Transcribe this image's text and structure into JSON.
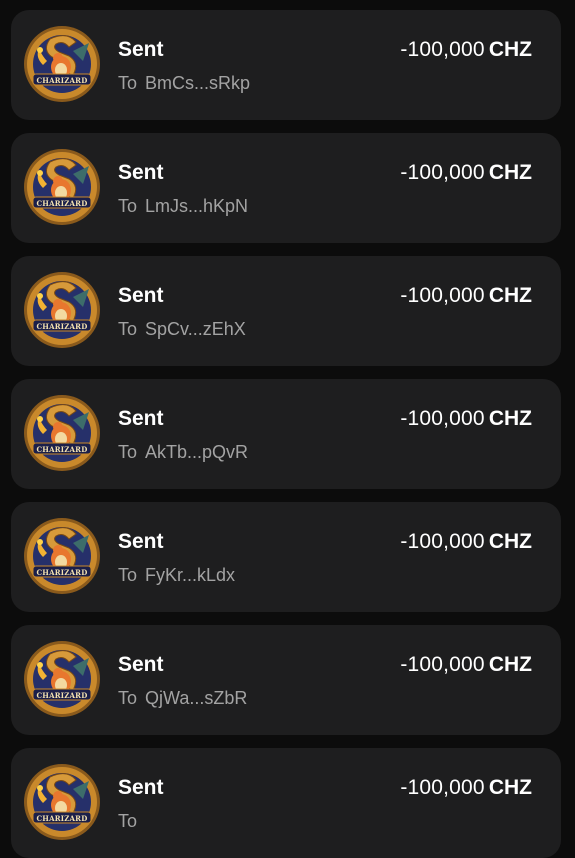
{
  "transactions": [
    {
      "title": "Sent",
      "to_label": "To",
      "address": "BmCs...sRkp",
      "amount": "-100,000",
      "currency": "CHZ",
      "token_logo_text": "CHARIZARD"
    },
    {
      "title": "Sent",
      "to_label": "To",
      "address": "LmJs...hKpN",
      "amount": "-100,000",
      "currency": "CHZ",
      "token_logo_text": "CHARIZARD"
    },
    {
      "title": "Sent",
      "to_label": "To",
      "address": "SpCv...zEhX",
      "amount": "-100,000",
      "currency": "CHZ",
      "token_logo_text": "CHARIZARD"
    },
    {
      "title": "Sent",
      "to_label": "To",
      "address": "AkTb...pQvR",
      "amount": "-100,000",
      "currency": "CHZ",
      "token_logo_text": "CHARIZARD"
    },
    {
      "title": "Sent",
      "to_label": "To",
      "address": "FyKr...kLdx",
      "amount": "-100,000",
      "currency": "CHZ",
      "token_logo_text": "CHARIZARD"
    },
    {
      "title": "Sent",
      "to_label": "To",
      "address": "QjWa...sZbR",
      "amount": "-100,000",
      "currency": "CHZ",
      "token_logo_text": "CHARIZARD"
    },
    {
      "title": "Sent",
      "to_label": "To",
      "address": "",
      "amount": "-100,000",
      "currency": "CHZ",
      "token_logo_text": "CHARIZARD"
    }
  ],
  "colors": {
    "background": "#0c0c0c",
    "card": "#1e1e1f",
    "primary_text": "#ffffff",
    "secondary_text": "#a3a3a3",
    "token_gold": "#c9892b",
    "token_navy": "#26306a"
  },
  "icons": {
    "token_avatar": "charizard-token-icon"
  }
}
